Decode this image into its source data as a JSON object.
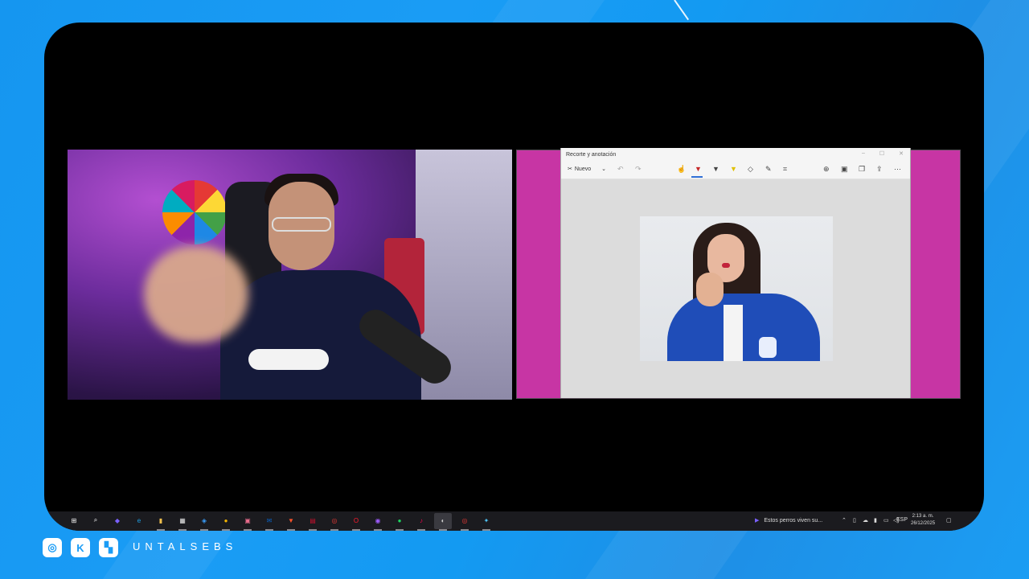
{
  "snip_window": {
    "title": "Recorte y anotación",
    "new_label": "Nuevo",
    "controls": [
      "–",
      "☐",
      "✕"
    ]
  },
  "taskbar": {
    "apps": [
      {
        "name": "windows-start",
        "glyph": "⊞",
        "color": "#ffffff"
      },
      {
        "name": "search",
        "glyph": "⌕",
        "color": "#ffffff"
      },
      {
        "name": "copilot",
        "glyph": "◆",
        "color": "#7b61ff"
      },
      {
        "name": "edge",
        "glyph": "e",
        "color": "#1fa2e8"
      },
      {
        "name": "file-explorer",
        "glyph": "▮",
        "color": "#f2c14e"
      },
      {
        "name": "calendar",
        "glyph": "▦",
        "color": "#e6e6e6"
      },
      {
        "name": "stack",
        "glyph": "◈",
        "color": "#3aa0ff"
      },
      {
        "name": "chrome",
        "glyph": "●",
        "color": "#f4b400"
      },
      {
        "name": "photos",
        "glyph": "▣",
        "color": "#e86c8c"
      },
      {
        "name": "outlook",
        "glyph": "✉",
        "color": "#0a64c8"
      },
      {
        "name": "brave",
        "glyph": "▼",
        "color": "#fb542b"
      },
      {
        "name": "media",
        "glyph": "▤",
        "color": "#c8102e"
      },
      {
        "name": "cc-red",
        "glyph": "◎",
        "color": "#e53935"
      },
      {
        "name": "opera",
        "glyph": "O",
        "color": "#ff1b2d"
      },
      {
        "name": "messenger",
        "glyph": "◉",
        "color": "#a05cff"
      },
      {
        "name": "spotify",
        "glyph": "●",
        "color": "#1ed760"
      },
      {
        "name": "tiktok",
        "glyph": "♪",
        "color": "#ff0050"
      },
      {
        "name": "obs",
        "glyph": "◐",
        "color": "#cccccc"
      },
      {
        "name": "cc-red-2",
        "glyph": "◎",
        "color": "#e53935"
      },
      {
        "name": "color-tool",
        "glyph": "✦",
        "color": "#4fc3f7"
      }
    ],
    "news_text": "Estos perros viven su...",
    "lang": "ESP",
    "time": "2:13 a. m.",
    "date": "26/12/2025"
  },
  "brand": {
    "name": "UNTALSEBS",
    "socials": [
      "instagram",
      "kick",
      "twitch"
    ]
  }
}
